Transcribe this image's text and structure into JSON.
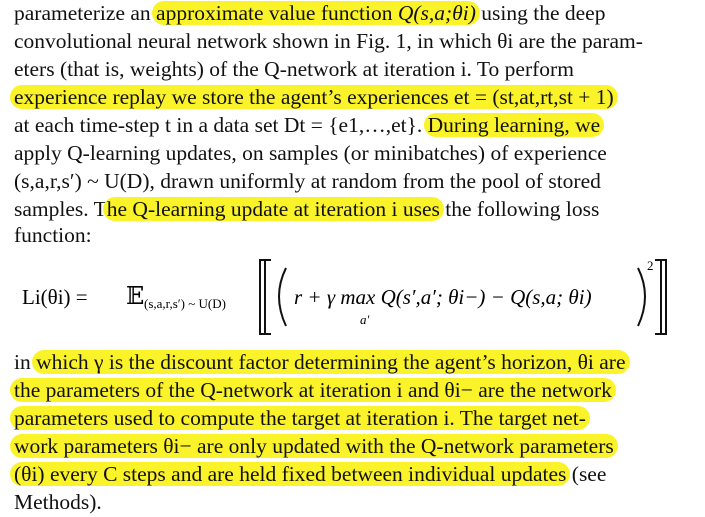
{
  "colors": {
    "highlight": "#fbf32a",
    "text": "#111111",
    "background": "#ffffff"
  },
  "paragraph1": {
    "line1": {
      "a": "parameterize an ",
      "b": "approximate value function ",
      "c": "Q(s,a;θi)",
      "d": " using the deep"
    },
    "line2": "convolutional neural network shown in Fig. 1, in which θi are the param-",
    "line3": "eters (that is, weights) of the Q-network at iteration i. To perform",
    "line4": "experience replay we store the agent’s experiences et = (st,at,rt,st + 1)",
    "line5": {
      "a": "at each time-step t in a data set Dt = {e1,…,et}. ",
      "b": "During learning, we"
    },
    "line6": "apply Q-learning updates, on samples (or minibatches) of experience",
    "line7": "(s,a,r,s′) ~ U(D), drawn uniformly at random from the pool of stored",
    "line8": {
      "a": "samples. T",
      "b": "he Q-learning update at iteration i uses",
      "c": " the following loss"
    },
    "line9": "function:"
  },
  "equation": {
    "lhs": "Li(θi) = ",
    "expectation": "𝔼",
    "expectation_sub": "(s,a,r,s′) ~ U(D)",
    "body": "r + γ max Q(s′,a′; θi−) − Q(s,a; θi)",
    "max_sub": "a′",
    "exponent": "2"
  },
  "paragraph2": {
    "line1": {
      "a": "in ",
      "b": "which γ is the discount factor determining the agent’s horizon, θi are"
    },
    "line2": "the parameters of the Q-network at iteration i and θi− are the network",
    "line3": "parameters used to compute the target at iteration i. The target net-",
    "line4": "work parameters θi− are only updated with the Q-network parameters",
    "line5": {
      "a": "(θi) every C steps and are held fixed between individual updates",
      "b": " (see"
    },
    "line6": "Methods)."
  }
}
